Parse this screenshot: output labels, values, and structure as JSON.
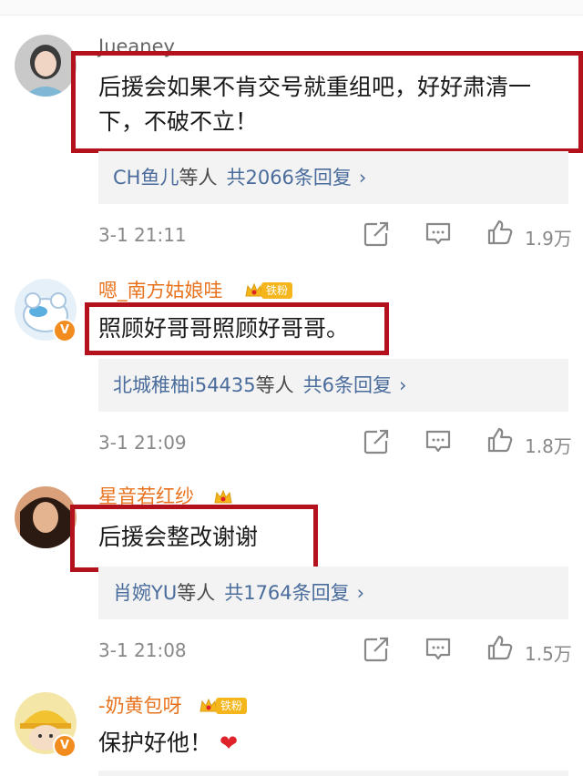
{
  "comments": [
    {
      "username": "Jueaney",
      "text_line1": "后援会如果不肯交号就重组吧，好好肃清一",
      "text_line2": "下，不破不立！",
      "reply_users": "CH鱼儿",
      "reply_deng": "等人",
      "reply_total": "共2066条回复",
      "time": "3-1 21:11",
      "likes": "1.9万"
    },
    {
      "username": "嗯_南方姑娘哇",
      "fan_label": "铁粉",
      "text_line1": "照顾好哥哥照顾好哥哥。",
      "reply_users": "北城稚柚i54435",
      "reply_deng": "等人",
      "reply_total": "共6条回复",
      "time": "3-1 21:09",
      "likes": "1.8万"
    },
    {
      "username": "星音若红纱",
      "text_line1": "后援会整改谢谢",
      "reply_users": "肖婉YU",
      "reply_deng": "等人",
      "reply_total": "共1764条回复",
      "time": "3-1 21:08",
      "likes": "1.5万"
    },
    {
      "username": "-奶黄包呀",
      "fan_label": "铁粉",
      "text_line1": "保护好他！"
    }
  ],
  "icons": {
    "chevron": "›",
    "verified": "V",
    "heart": "❤"
  },
  "colors": {
    "username_orange": "#e8731e",
    "link_blue": "#4a6c9c",
    "highlight_red": "#b3121c",
    "reply_bg": "#f3f3f3"
  }
}
